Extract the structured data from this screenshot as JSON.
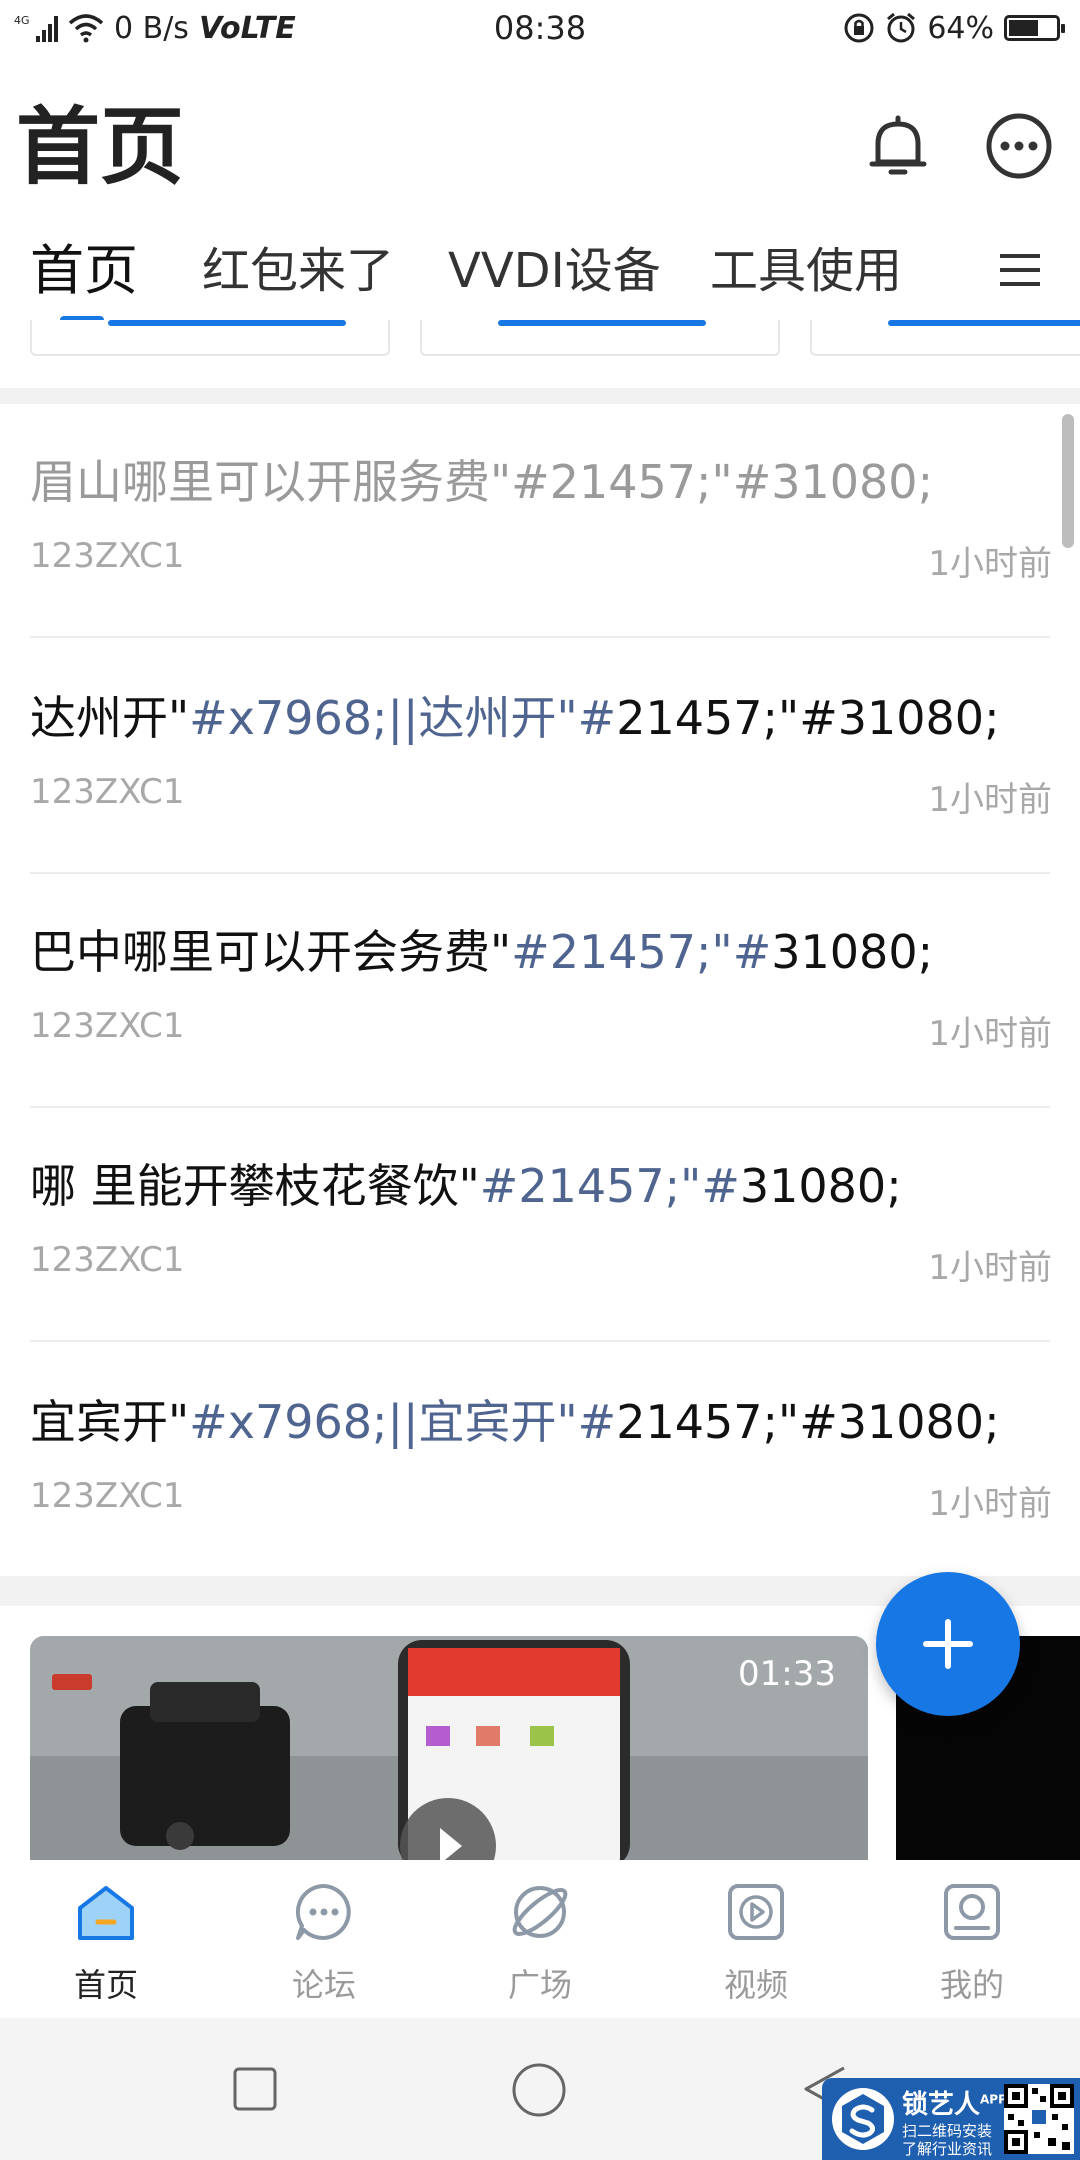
{
  "status_bar": {
    "signal": "4G",
    "net_speed": "0 B/s",
    "volte": "VoLTE",
    "time": "08:38",
    "battery": "64%",
    "battery_level": 0.64
  },
  "header": {
    "title": "首页"
  },
  "tabs": [
    {
      "label": "首页"
    },
    {
      "label": "红包来了"
    },
    {
      "label": "VVDI设备"
    },
    {
      "label": "工具使用"
    }
  ],
  "posts": [
    {
      "title_parts": [
        "眉山哪里可以开服务费\"#21457;\"#31080;"
      ],
      "author": "123ZXC1",
      "time": "1小时前"
    },
    {
      "title_parts": [
        "达州开\"",
        "#x7968;||达州开\"#",
        "21457;\"#31080;"
      ],
      "author": "123ZXC1",
      "time": "1小时前"
    },
    {
      "title_parts": [
        "巴中哪里可以开会务费\"",
        "#21457;\"#",
        "31080;"
      ],
      "author": "123ZXC1",
      "time": "1小时前"
    },
    {
      "title_parts": [
        "哪 里能开攀枝花餐饮\"",
        "#21457;\"#",
        "31080;"
      ],
      "author": "123ZXC1",
      "time": "1小时前"
    },
    {
      "title_parts": [
        "宜宾开\"",
        "#x7968;||宜宾开\"#",
        "21457;\"#31080;"
      ],
      "author": "123ZXC1",
      "time": "1小时前"
    }
  ],
  "video": {
    "duration": "01:33"
  },
  "bottom_nav": [
    {
      "label": "首页",
      "icon": "home-icon"
    },
    {
      "label": "论坛",
      "icon": "forum-icon"
    },
    {
      "label": "广场",
      "icon": "planet-icon"
    },
    {
      "label": "视频",
      "icon": "video-icon"
    },
    {
      "label": "我的",
      "icon": "profile-icon"
    }
  ],
  "watermark": {
    "name": "锁艺人",
    "sup": "APP",
    "line1": "扫二维码安装",
    "line2": "了解行业资讯"
  },
  "colors": {
    "accent": "#1677e5",
    "highlight_text": "#4f6590",
    "muted": "#a8a8a8"
  }
}
